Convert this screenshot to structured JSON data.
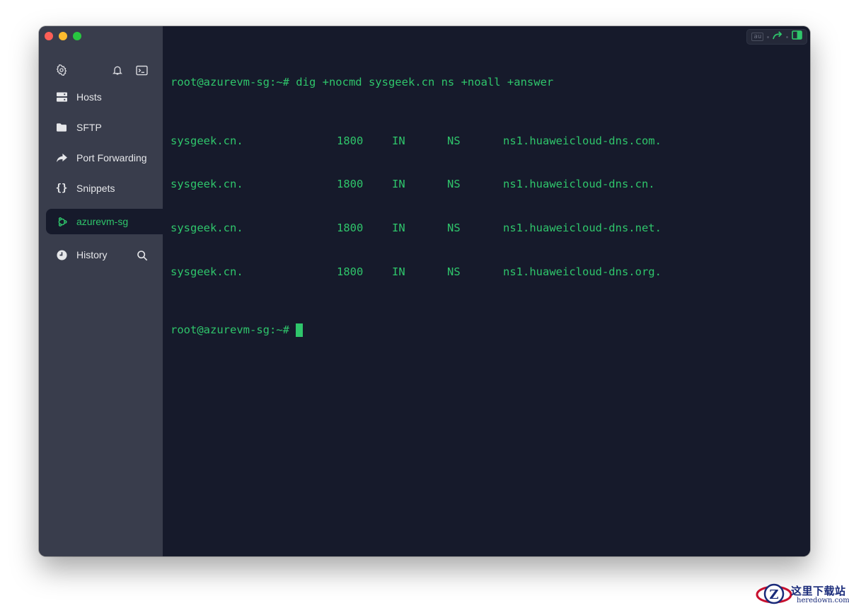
{
  "sidebar": {
    "nav_items": [
      {
        "label": "Hosts"
      },
      {
        "label": "SFTP"
      },
      {
        "label": "Port Forwarding"
      },
      {
        "label": "Snippets"
      }
    ],
    "active_session": {
      "label": "azurevm-sg"
    },
    "history": {
      "label": "History"
    }
  },
  "toolbar": {
    "input_mode_label": "au"
  },
  "terminal": {
    "command_line": "root@azurevm-sg:~# dig +nocmd sysgeek.cn ns +noall +answer",
    "records": [
      {
        "name": "sysgeek.cn.",
        "ttl": "1800",
        "class": "IN",
        "type": "NS",
        "value": "ns1.huaweicloud-dns.com."
      },
      {
        "name": "sysgeek.cn.",
        "ttl": "1800",
        "class": "IN",
        "type": "NS",
        "value": "ns1.huaweicloud-dns.cn."
      },
      {
        "name": "sysgeek.cn.",
        "ttl": "1800",
        "class": "IN",
        "type": "NS",
        "value": "ns1.huaweicloud-dns.net."
      },
      {
        "name": "sysgeek.cn.",
        "ttl": "1800",
        "class": "IN",
        "type": "NS",
        "value": "ns1.huaweicloud-dns.org."
      }
    ],
    "prompt": "root@azurevm-sg:~# "
  },
  "watermark": {
    "site_cn": "这里下载站",
    "site_en": "heredown.com"
  },
  "colors": {
    "accent": "#2fc56b",
    "terminal_bg": "#161a2b",
    "sidebar_bg": "#393d4c"
  },
  "icons": {
    "settings": "gear-icon",
    "notifications": "bell-icon",
    "terminal": "terminal-icon",
    "hosts": "server-icon",
    "sftp": "folder-icon",
    "port_forwarding": "forward-arrow-icon",
    "snippets": "braces-icon",
    "session": "ubuntu-icon",
    "history": "clock-icon",
    "search": "search-icon"
  }
}
